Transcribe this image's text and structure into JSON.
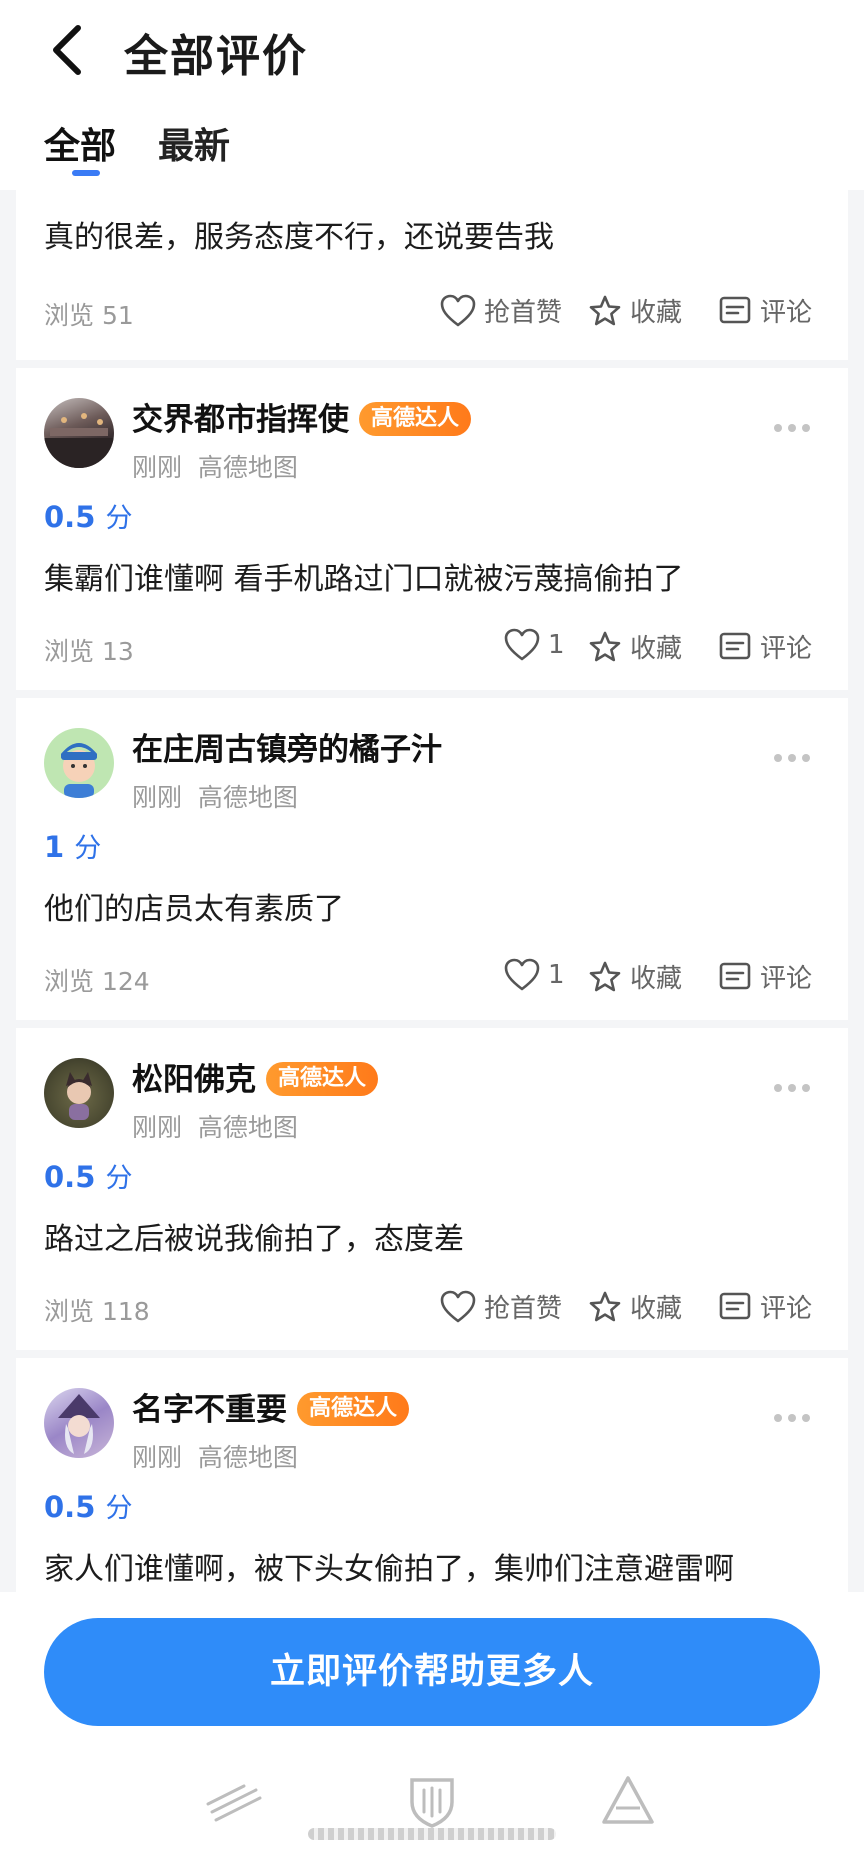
{
  "header": {
    "title": "全部评价",
    "tabs": [
      {
        "label": "全部"
      },
      {
        "label": "最新"
      }
    ]
  },
  "actions": {
    "like_first": "抢首赞",
    "collect": "收藏",
    "comment": "评论"
  },
  "reviews": [
    {
      "text": "真的很差，服务态度不行，还说要告我",
      "views": "浏览 51",
      "likes": "抢首赞"
    },
    {
      "name": "交界都市指挥使",
      "badge": "高德达人",
      "time": "刚刚",
      "source": "高德地图",
      "score": "0.5",
      "unit": "分",
      "text": "集霸们谁懂啊 看手机路过门口就被污蔑搞偷拍了",
      "views": "浏览 13",
      "likes": "1"
    },
    {
      "name": "在庄周古镇旁的橘子汁",
      "time": "刚刚",
      "source": "高德地图",
      "score": "1",
      "unit": "分",
      "text": "他们的店员太有素质了",
      "views": "浏览 124",
      "likes": "1"
    },
    {
      "name": "松阳佛克",
      "badge": "高德达人",
      "time": "刚刚",
      "source": "高德地图",
      "score": "0.5",
      "unit": "分",
      "text": "路过之后被说我偷拍了，态度差",
      "views": "浏览 118",
      "likes": "抢首赞"
    },
    {
      "name": "名字不重要",
      "badge": "高德达人",
      "time": "刚刚",
      "source": "高德地图",
      "score": "0.5",
      "unit": "分",
      "text": "家人们谁懂啊，被下头女偷拍了，集帅们注意避雷啊"
    }
  ],
  "cta": {
    "label": "立即评价帮助更多人"
  },
  "colors": {
    "accent": "#2f72e8",
    "button": "#2f8cf9",
    "badge": "#ff8a22"
  }
}
